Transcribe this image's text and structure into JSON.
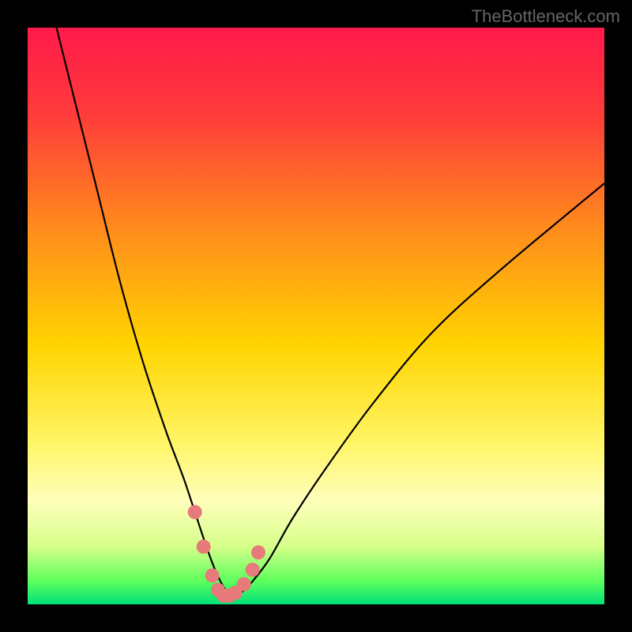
{
  "watermark": "TheBottleneck.com",
  "chart_data": {
    "type": "line",
    "title": "",
    "xlabel": "",
    "ylabel": "",
    "xlim": [
      0,
      100
    ],
    "ylim": [
      0,
      100
    ],
    "background_gradient": {
      "stops": [
        {
          "pos": 0.0,
          "color": "#ff1a4a"
        },
        {
          "pos": 0.15,
          "color": "#ff3b3b"
        },
        {
          "pos": 0.35,
          "color": "#ff8c1c"
        },
        {
          "pos": 0.55,
          "color": "#ffd400"
        },
        {
          "pos": 0.72,
          "color": "#fff566"
        },
        {
          "pos": 0.82,
          "color": "#ffffbb"
        },
        {
          "pos": 0.9,
          "color": "#d6ff8a"
        },
        {
          "pos": 0.96,
          "color": "#5cff5c"
        },
        {
          "pos": 1.0,
          "color": "#00e07a"
        }
      ]
    },
    "series": [
      {
        "name": "bottleneck-curve",
        "color": "#000000",
        "x": [
          5,
          8,
          12,
          16,
          20,
          24,
          27,
          29,
          31,
          32.5,
          34,
          35.5,
          37,
          39,
          42,
          46,
          52,
          60,
          70,
          82,
          100
        ],
        "y": [
          100,
          88,
          72,
          56,
          42,
          30,
          22,
          16,
          10,
          6,
          3,
          1.5,
          2,
          4,
          8,
          15,
          24,
          35,
          47,
          58,
          73
        ]
      }
    ],
    "highlight": {
      "name": "min-region",
      "color": "#e77a7a",
      "x": [
        29,
        30.5,
        32,
        33,
        34,
        35,
        36,
        37.5,
        39,
        40
      ],
      "y": [
        16,
        10,
        5,
        2.5,
        1.5,
        1.5,
        2,
        3.5,
        6,
        9
      ]
    }
  }
}
